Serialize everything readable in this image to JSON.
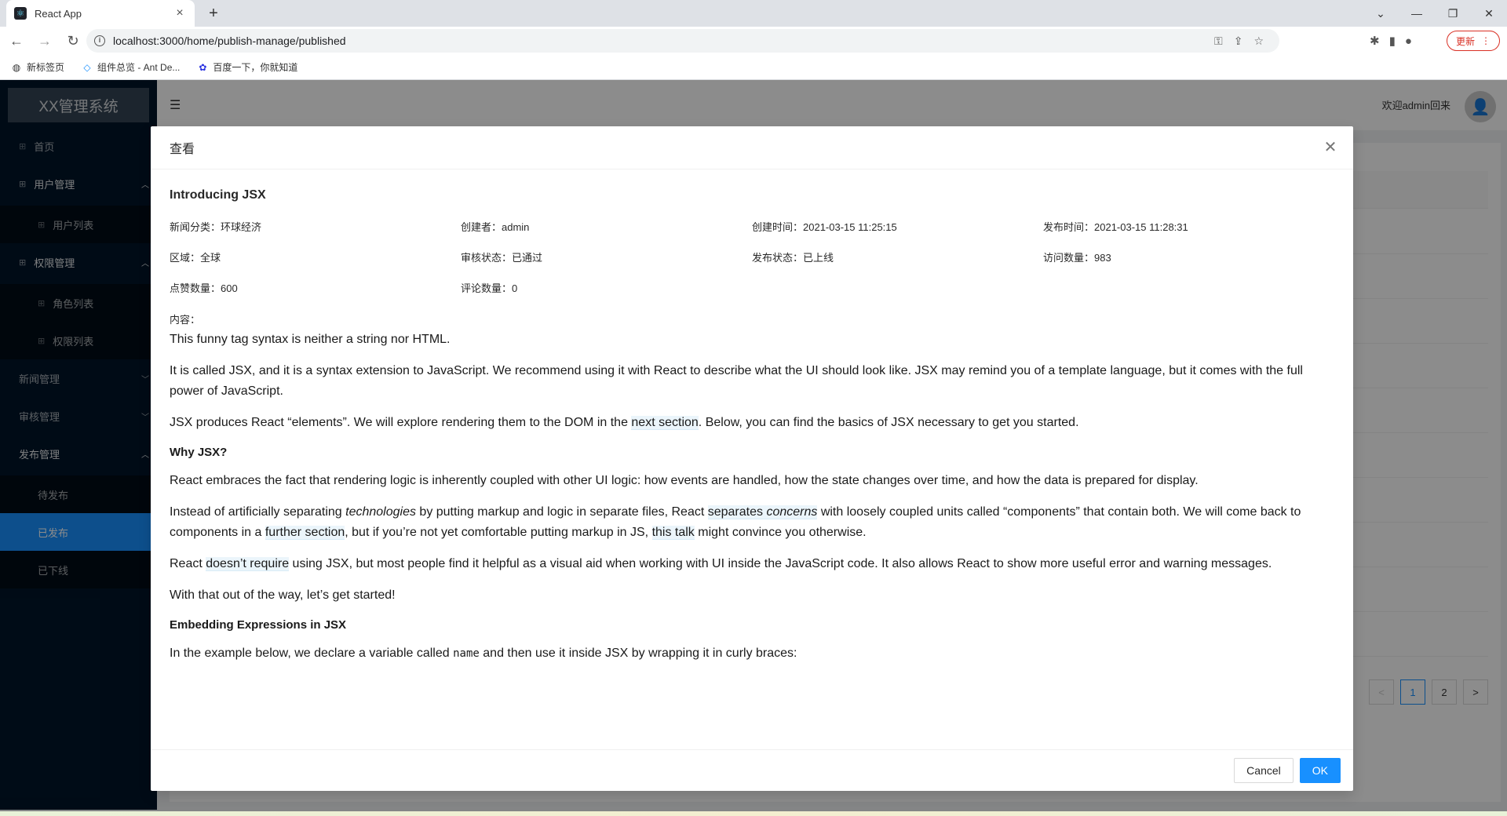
{
  "browser": {
    "tab_title": "React App",
    "tab_favicon": "⚛",
    "url": "localhost:3000/home/publish-manage/published",
    "update_label": "更新",
    "bookmarks": [
      {
        "label": "新标签页",
        "icon": "globe-icon"
      },
      {
        "label": "组件总览 - Ant De...",
        "icon": "ant-design-icon"
      },
      {
        "label": "百度一下，你就知道",
        "icon": "baidu-paw-icon"
      }
    ]
  },
  "sider": {
    "logo": "XX管理系统",
    "items": [
      {
        "label": "首页"
      },
      {
        "label": "用户管理"
      },
      {
        "label": "用户列表"
      },
      {
        "label": "权限管理"
      },
      {
        "label": "角色列表"
      },
      {
        "label": "权限列表"
      },
      {
        "label": "新闻管理"
      },
      {
        "label": "审核管理"
      },
      {
        "label": "发布管理"
      },
      {
        "label": "待发布"
      },
      {
        "label": "已发布"
      },
      {
        "label": "已下线"
      }
    ]
  },
  "header": {
    "welcome": "欢迎admin回来"
  },
  "pagination": {
    "pages": [
      "1",
      "2"
    ],
    "prev": "<",
    "next": ">"
  },
  "modal": {
    "title": "查看",
    "news_title": "Introducing JSX",
    "fields": [
      {
        "text": "新闻分类：环球经济"
      },
      {
        "text": "创建者：admin"
      },
      {
        "text": "创建时间：2021-03-15 11:25:15"
      },
      {
        "text": "发布时间：2021-03-15 11:28:31"
      },
      {
        "text": "区域：全球"
      },
      {
        "text": "审核状态：已通过"
      },
      {
        "text": "发布状态：已上线"
      },
      {
        "text": "访问数量：983"
      },
      {
        "text": "点赞数量：600"
      },
      {
        "text": "评论数量：0"
      }
    ],
    "content_label": "内容：",
    "article": {
      "p1": "This funny tag syntax is neither a string nor HTML.",
      "p2": "It is called JSX, and it is a syntax extension to JavaScript. We recommend using it with React to describe what the UI should look like. JSX may remind you of a template language, but it comes with the full power of JavaScript.",
      "p3a": "JSX produces React “elements”. We will explore rendering them to the DOM in the ",
      "p3link": "next section",
      "p3b": ". Below, you can find the basics of JSX necessary to get you started.",
      "h1": "Why JSX?",
      "p4": "React embraces the fact that rendering logic is inherently coupled with other UI logic: how events are handled, how the state changes over time, and how the data is prepared for display.",
      "p5a": "Instead of artificially separating ",
      "p5em1": "technologies",
      "p5b": " by putting markup and logic in separate files, React ",
      "p5link1": "separates ",
      "p5em2": "concerns",
      "p5c": " with loosely coupled units called “components” that contain both. We will come back to components in a ",
      "p5link2": "further section",
      "p5d": ", but if you’re not yet comfortable putting markup in JS, ",
      "p5link3": "this talk",
      "p5e": " might convince you otherwise.",
      "p6a": "React ",
      "p6link": "doesn’t require",
      "p6b": " using JSX, but most people find it helpful as a visual aid when working with UI inside the JavaScript code. It also allows React to show more useful error and warning messages.",
      "p7": "With that out of the way, let’s get started!",
      "h2": "Embedding Expressions in JSX",
      "p8a": "In the example below, we declare a variable called ",
      "p8code": "name",
      "p8b": " and then use it inside JSX by wrapping it in curly braces:"
    },
    "cancel_label": "Cancel",
    "ok_label": "OK"
  },
  "colors": {
    "primary": "#1890ff",
    "sider_bg": "#001529",
    "update_red": "#d93025"
  }
}
